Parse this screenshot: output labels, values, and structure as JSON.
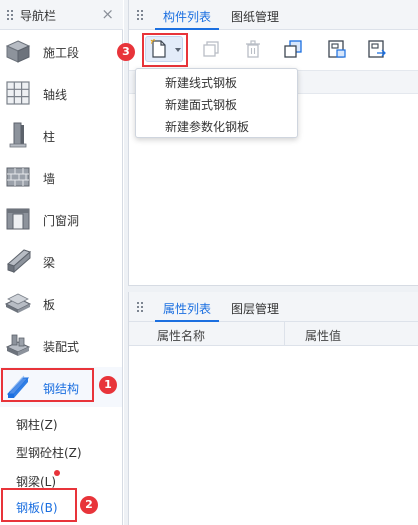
{
  "nav": {
    "title": "导航栏",
    "close": "×",
    "items": [
      {
        "label": "施工段",
        "icon": "cube-icon"
      },
      {
        "label": "轴线",
        "icon": "grid-icon"
      },
      {
        "label": "柱",
        "icon": "column-icon"
      },
      {
        "label": "墙",
        "icon": "brick-wall-icon"
      },
      {
        "label": "门窗洞",
        "icon": "door-window-icon"
      },
      {
        "label": "梁",
        "icon": "beam-icon"
      },
      {
        "label": "板",
        "icon": "slab-icon"
      },
      {
        "label": "装配式",
        "icon": "prefab-icon"
      },
      {
        "label": "钢结构",
        "icon": "steel-structure-icon"
      }
    ],
    "sub_items": [
      {
        "label": "钢柱(Z)"
      },
      {
        "label": "型钢砼柱(Z)"
      },
      {
        "label": "钢梁(L)"
      },
      {
        "label": "钢板(B)"
      }
    ]
  },
  "component_panel": {
    "tabs": [
      "构件列表",
      "图纸管理"
    ],
    "menu_items": [
      "新建线式钢板",
      "新建面式钢板",
      "新建参数化钢板"
    ]
  },
  "property_panel": {
    "tabs": [
      "属性列表",
      "图层管理"
    ],
    "columns": [
      "属性名称",
      "属性值"
    ]
  },
  "badges": [
    "1",
    "2",
    "3"
  ],
  "colors": {
    "accent": "#1b6fe0",
    "highlight": "#e8343a",
    "header_bg": "#f3f5f8"
  }
}
